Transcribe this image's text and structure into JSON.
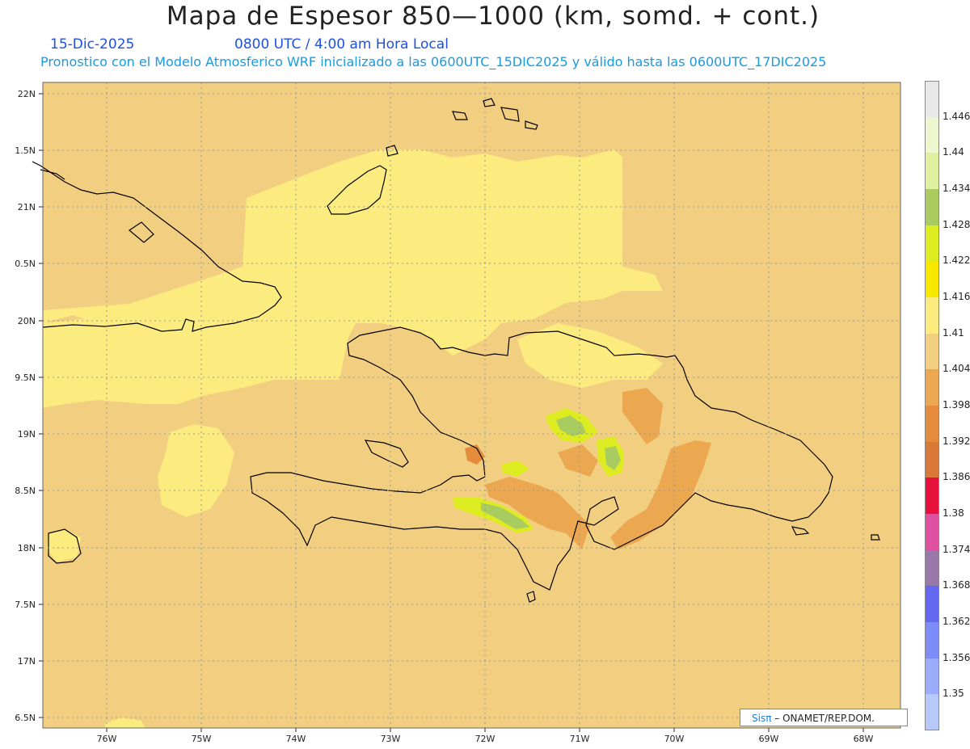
{
  "header": {
    "title": "Mapa de Espesor 850—1000 (km, somd. + cont.)",
    "date": "15-Dic-2025",
    "time": "0800 UTC / 4:00 am Hora Local",
    "description": "Pronostico con el Modelo Atmosferico WRF inicializado a las 0600UTC_15DIC2025 y válido hasta las  0600UTC_17DIC2025"
  },
  "axes": {
    "lat_labels": [
      "22N",
      "1.5N",
      "21N",
      "0.5N",
      "20N",
      "9.5N",
      "19N",
      "8.5N",
      "18N",
      "7.5N",
      "17N",
      "6.5N"
    ],
    "lon_labels": [
      "76W",
      "75W",
      "74W",
      "73W",
      "72W",
      "71W",
      "70W",
      "69W",
      "68W"
    ]
  },
  "colorbar": {
    "labels": [
      "1.446",
      "1.44",
      "1.434",
      "1.428",
      "1.422",
      "1.416",
      "1.41",
      "1.404",
      "1.398",
      "1.392",
      "1.386",
      "1.38",
      "1.374",
      "1.368",
      "1.362",
      "1.356",
      "1.35"
    ],
    "colors": [
      "#e8e8e8",
      "#eef6d0",
      "#e0f0a0",
      "#a8cc60",
      "#dcec20",
      "#f8e800",
      "#fcec80",
      "#f2cf80",
      "#eca850",
      "#e48c3c",
      "#da7838",
      "#e8103c",
      "#e050a0",
      "#9878a8",
      "#6468f0",
      "#7c8cf8",
      "#9aacfa",
      "#b8c8fa"
    ]
  },
  "credit": {
    "brand": "Sisπ",
    "text": "– ONAMET/REP.DOM."
  },
  "colors": {
    "background_field": "#f2cf80",
    "light_field": "#fcec80",
    "dark_field": "#eca850",
    "green_field": "#a8cc60",
    "yellow_field": "#dcec20",
    "coast": "#000000"
  }
}
